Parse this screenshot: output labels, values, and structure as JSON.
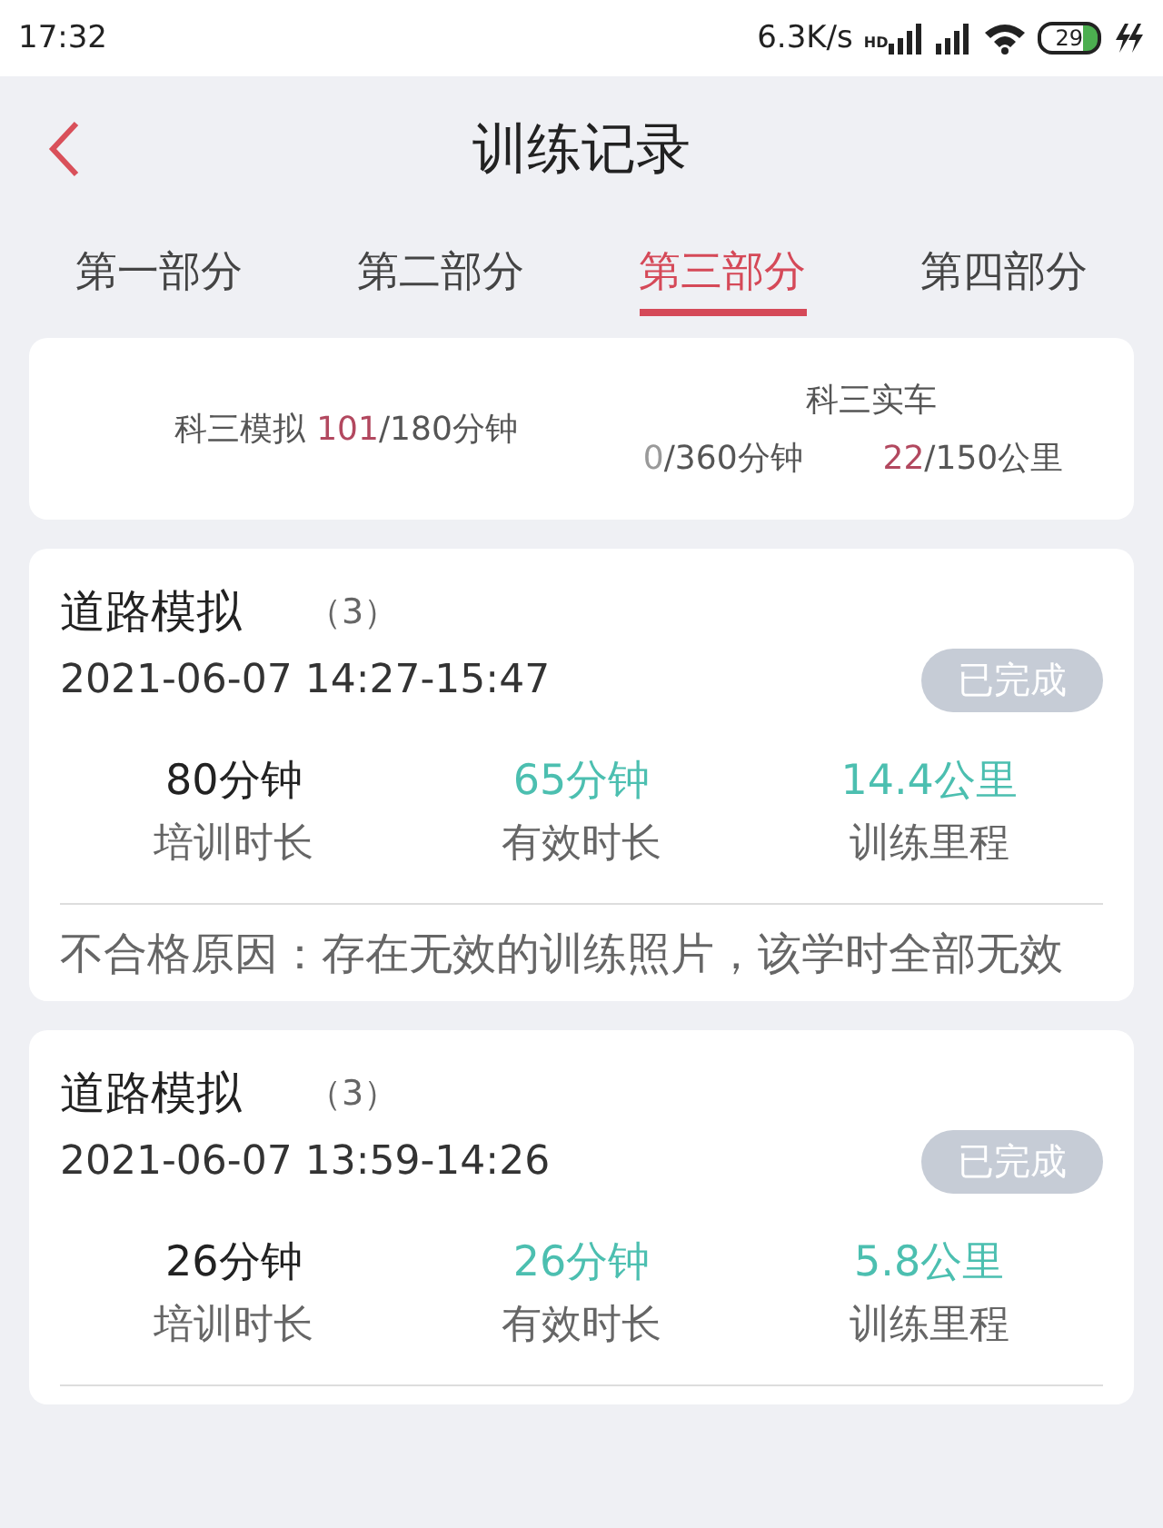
{
  "status_bar": {
    "time": "17:32",
    "speed": "6.3K/s",
    "network_badge": "HD",
    "battery": "29"
  },
  "header": {
    "title": "训练记录"
  },
  "tabs": [
    {
      "label": "第一部分",
      "selected": false
    },
    {
      "label": "第二部分",
      "selected": false
    },
    {
      "label": "第三部分",
      "selected": true
    },
    {
      "label": "第四部分",
      "selected": false
    }
  ],
  "summary": {
    "simulator": {
      "label": "科三模拟",
      "done": "101",
      "color": "#b2485f",
      "total": "/180分钟"
    },
    "real_car": {
      "title": "科三实车",
      "parts": [
        {
          "done": "0",
          "color": "#9a9a9a",
          "total": "/360分钟"
        },
        {
          "done": "22",
          "color": "#b2485f",
          "total": "/150公里"
        }
      ]
    }
  },
  "records": [
    {
      "title": "道路模拟",
      "count": "（3）",
      "time": "2021-06-07 14:27-15:47",
      "status": "已完成",
      "stats": [
        {
          "value": "80分钟",
          "color": "#222222",
          "label": "培训时长"
        },
        {
          "value": "65分钟",
          "color": "#4cbfb0",
          "label": "有效时长"
        },
        {
          "value": "14.4公里",
          "color": "#4cbfb0",
          "label": "训练里程"
        }
      ],
      "reason": "不合格原因：存在无效的训练照片，该学时全部无效"
    },
    {
      "title": "道路模拟",
      "count": "（3）",
      "time": "2021-06-07 13:59-14:26",
      "status": "已完成",
      "stats": [
        {
          "value": "26分钟",
          "color": "#222222",
          "label": "培训时长"
        },
        {
          "value": "26分钟",
          "color": "#4cbfb0",
          "label": "有效时长"
        },
        {
          "value": "5.8公里",
          "color": "#4cbfb0",
          "label": "训练里程"
        }
      ]
    }
  ]
}
